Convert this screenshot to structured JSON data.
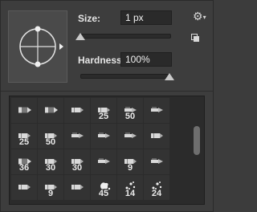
{
  "size": {
    "label": "Size:",
    "value": "1 px",
    "level": 0.0
  },
  "hardness": {
    "label": "Hardness:",
    "value": "100%",
    "level": 1.0
  },
  "icons": {
    "angle_preview": "brush-angle-roundness-icon",
    "settings": "gear-icon",
    "new_preset": "new-preset-icon",
    "brush": "brush-tip-icon"
  },
  "presets": [
    {
      "icon": "hard-tip",
      "label": ""
    },
    {
      "icon": "hard-tip",
      "label": ""
    },
    {
      "icon": "pencil",
      "label": ""
    },
    {
      "icon": "pencil",
      "label": "25"
    },
    {
      "icon": "brush",
      "label": "50"
    },
    {
      "icon": "brush",
      "label": ""
    },
    {
      "icon": "pencil",
      "label": "25"
    },
    {
      "icon": "pencil",
      "label": "50"
    },
    {
      "icon": "brush",
      "label": ""
    },
    {
      "icon": "brush",
      "label": ""
    },
    {
      "icon": "brush",
      "label": ""
    },
    {
      "icon": "pencil",
      "label": ""
    },
    {
      "icon": "hard-tip",
      "label": "36"
    },
    {
      "icon": "pencil",
      "label": "30"
    },
    {
      "icon": "pencil",
      "label": "30"
    },
    {
      "icon": "brush",
      "label": ""
    },
    {
      "icon": "pencil",
      "label": "9"
    },
    {
      "icon": "brush",
      "label": ""
    },
    {
      "icon": "pencil",
      "label": ""
    },
    {
      "icon": "pencil",
      "label": "9"
    },
    {
      "icon": "pencil",
      "label": ""
    },
    {
      "icon": "splat",
      "label": "45"
    },
    {
      "icon": "scatter",
      "label": "14"
    },
    {
      "icon": "scatter",
      "label": "24"
    }
  ],
  "colors": {
    "panel": "#3d3d3d",
    "field": "#2a2a2a",
    "grid": "#2b2b2b",
    "text": "#e6e6e6"
  }
}
